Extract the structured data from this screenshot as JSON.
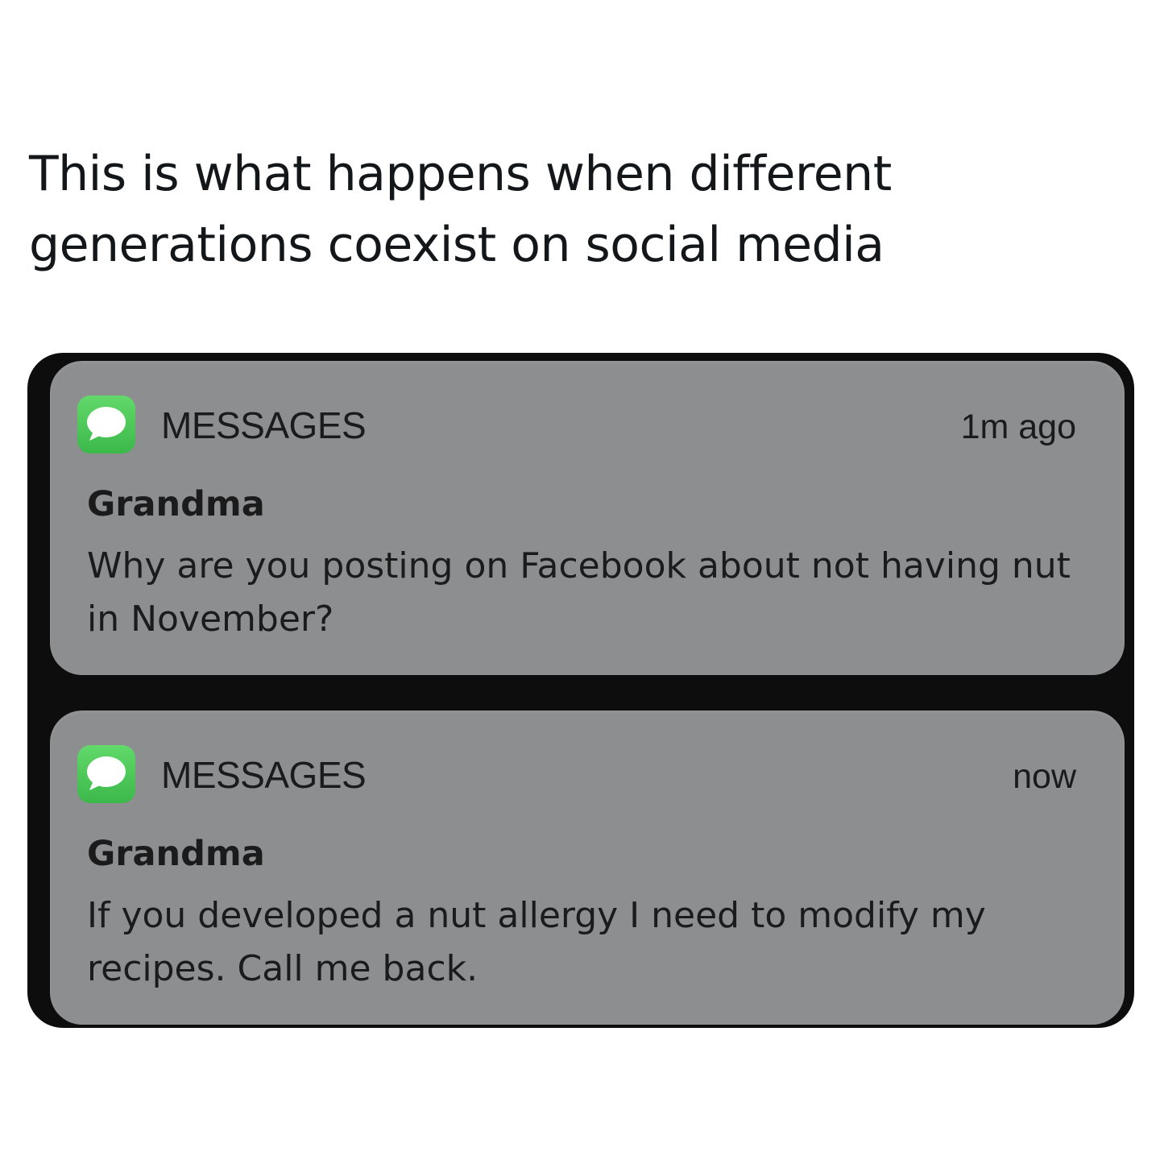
{
  "post": {
    "caption": "This is what happens when different generations coexist on social media"
  },
  "notifications": [
    {
      "app_name": "MESSAGES",
      "app_icon": "messages-bubble-icon",
      "timestamp": "1m ago",
      "sender": "Grandma",
      "message": "Why are you posting on Facebook about not having nut in November?"
    },
    {
      "app_name": "MESSAGES",
      "app_icon": "messages-bubble-icon",
      "timestamp": "now",
      "sender": "Grandma",
      "message": "If you developed a nut allergy I need to modify my recipes. Call me back."
    }
  ],
  "colors": {
    "card_background": "#8d8e90",
    "screen_background": "#0d0d0e",
    "messages_icon_green": "#4cc95a"
  }
}
